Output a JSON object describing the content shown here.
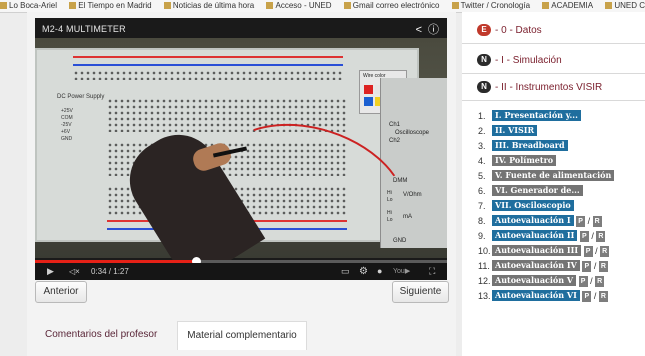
{
  "bookmarks": [
    "Lo Boca-Ariel",
    "El Tiempo en Madrid",
    "Noticias de última hora",
    "Acceso - UNED",
    "Gmail correo electrónico",
    "Twitter / Cronología",
    "ACADEMIA",
    "UNED C"
  ],
  "video": {
    "title": "M2-4 MULTIMETER",
    "time": "0:34 / 1:27",
    "progress_fraction": 0.39,
    "board_labels": {
      "dc_supply": "DC Power Supply",
      "wire_color": "Wire color",
      "ch1": "Ch1",
      "ch2": "Ch2",
      "oscilloscope": "Oscilloscope",
      "dmm": "DMM",
      "hi1": "Hi",
      "lo1": "Lo",
      "vohm": "V/Ohm",
      "hi2": "Hi",
      "lo2": "Lo",
      "ma": "mA",
      "gnd": "GND",
      "pos25": "+25V",
      "com": "COM",
      "neg25": "-25V",
      "pos6": "+6V",
      "gnd2": "GND"
    }
  },
  "nav": {
    "prev": "Anterior",
    "next": "Siguiente"
  },
  "tabs": [
    {
      "label": "Comentarios del profesor"
    },
    {
      "label": "Material complementario"
    }
  ],
  "sidebar": {
    "sections": [
      {
        "badge": "E",
        "label": "- 0 - Datos",
        "badge_color": "#c0392b"
      },
      {
        "badge": "N",
        "label": "- I - Simulación",
        "badge_color": "#2b2b2b"
      },
      {
        "badge": "N",
        "label": "- II - Instrumentos VISIR",
        "badge_color": "#2b2b2b"
      }
    ],
    "items": [
      {
        "num": "1.",
        "label": "I. Presentación y...",
        "color": "blue"
      },
      {
        "num": "2.",
        "label": "II. VISIR",
        "color": "blue"
      },
      {
        "num": "3.",
        "label": "III. Breadboard",
        "color": "blue"
      },
      {
        "num": "4.",
        "label": "IV. Polímetro",
        "color": "gray"
      },
      {
        "num": "5.",
        "label": "V. Fuente de alimentación",
        "color": "gray"
      },
      {
        "num": "6.",
        "label": "VI. Generador de...",
        "color": "gray"
      },
      {
        "num": "7.",
        "label": "VII. Osciloscopio",
        "color": "blue"
      },
      {
        "num": "8.",
        "label": "Autoevaluación I",
        "color": "blue",
        "p": "P",
        "sep": "/",
        "r": "R"
      },
      {
        "num": "9.",
        "label": "Autoevaluación II",
        "color": "blue",
        "p": "P",
        "sep": "/",
        "r": "R"
      },
      {
        "num": "10.",
        "label": "Autoevaluación III",
        "color": "gray",
        "p": "P",
        "sep": "/",
        "r": "R"
      },
      {
        "num": "11.",
        "label": "Autoevaluación IV",
        "color": "gray",
        "p": "P",
        "sep": "/",
        "r": "R"
      },
      {
        "num": "12.",
        "label": "Autoevaluación V",
        "color": "gray",
        "p": "P",
        "sep": "/",
        "r": "R"
      },
      {
        "num": "13.",
        "label": "Autoevaluación VI",
        "color": "blue",
        "p": "P",
        "sep": "/",
        "r": "R"
      }
    ]
  },
  "colors": {
    "accent_red": "#e62117",
    "tag_blue": "#1f6e9e",
    "tag_gray": "#747474",
    "section_text": "#7a1e2c"
  }
}
